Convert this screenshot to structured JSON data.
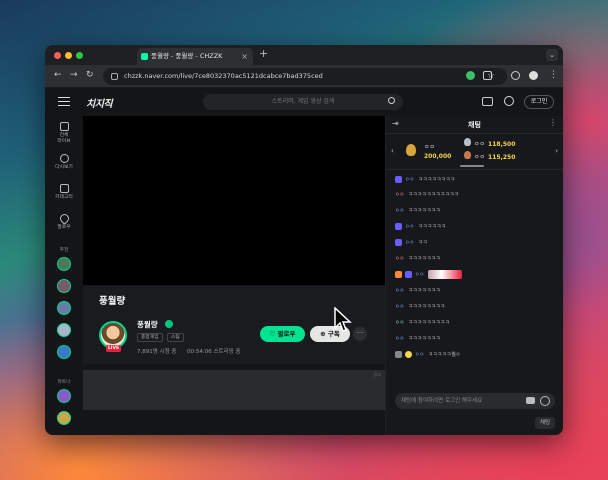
{
  "browser": {
    "tab_title": "풍월량 - 풍월량 - CHZZK",
    "new_tab": "+",
    "url": "chzzk.naver.com/live/7ce8032370ac5121dcabce7bad375ced"
  },
  "site": {
    "logo": "치지직",
    "search_placeholder": "스트리머, 게임 영상 검색",
    "login_label": "로그인"
  },
  "sidebar": {
    "items": [
      {
        "label": "전체\n라이브",
        "icon": "live-icon"
      },
      {
        "label": "다시보기",
        "icon": "replay-icon"
      },
      {
        "label": "카테고리",
        "icon": "category-icon"
      },
      {
        "label": "팔로우",
        "icon": "heart-icon"
      }
    ],
    "section_recommended": "추천",
    "section_partner": "파트너"
  },
  "stream": {
    "title": "풍월량",
    "channel_name": "풍월량",
    "tags": [
      "종합게임",
      "스팀"
    ],
    "viewers": "7,891명 시청 중",
    "duration": "00:54:06 스트리밍 중",
    "live_badge": "LIVE",
    "follow_label": "팔로우",
    "subscribe_label": "구독",
    "more_label": "···"
  },
  "banner": {
    "label": "광고"
  },
  "chat": {
    "title": "채팅",
    "ranks": [
      {
        "name": "ㅇㅇ",
        "amount": "200,000"
      },
      {
        "name": "ㅇㅇ",
        "amount": "118,500"
      },
      {
        "name": "ㅇㅇ",
        "amount": "115,250"
      }
    ],
    "messages": [
      {
        "nick": "ㅇㅇ",
        "text": "ㅋㅋㅋㅋㅋㅋㅋㅋ"
      },
      {
        "nick": "ㅇㅇ",
        "text": "ㅋㅋㅋㅋㅋㅋㅋㅋㅋㅋㅋ"
      },
      {
        "nick": "ㅇㅇ",
        "text": "ㅋㅋㅋㅋㅋㅋㅋ"
      },
      {
        "nick": "ㅇㅇ",
        "text": "ㅋㅋㅋㅋㅋㅋ"
      },
      {
        "nick": "ㅇㅇ",
        "text": "ㅋㅋ"
      },
      {
        "nick": "ㅇㅇ",
        "text": "ㅋㅋㅋㅋㅋㅋㅋ"
      },
      {
        "nick": "ㅇㅇ",
        "text": ""
      },
      {
        "nick": "ㅇㅇ",
        "text": "ㅋㅋㅋㅋㅋㅋㅋ"
      },
      {
        "nick": "ㅇㅇ",
        "text": "ㅋㅋㅋㅋㅋㅋㅋㅋ"
      },
      {
        "nick": "ㅇㅇ",
        "text": "ㅋㅋㅋㅋㅋㅋㅋㅋㅋ"
      },
      {
        "nick": "ㅇㅇ",
        "text": "ㅋㅋㅋㅋㅋㅋㅋ"
      },
      {
        "nick": "ㅇㅇ",
        "text": "ㅋㅋㅋㅋㅋ월ㅇ"
      }
    ],
    "input_placeholder": "채팅에 참여하려면 로그인 해주세요",
    "send_label": "채팅"
  },
  "colors": {
    "accent": "#00e390",
    "live": "#e8223b",
    "donation": "#f8d64a"
  }
}
